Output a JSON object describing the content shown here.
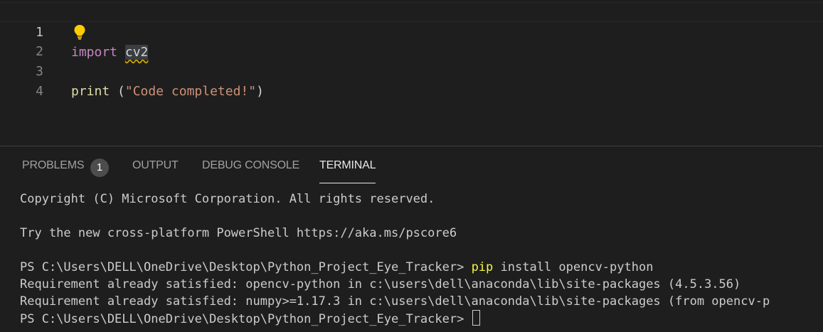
{
  "editor": {
    "line_numbers": [
      "1",
      "2",
      "3",
      "4"
    ],
    "line1": {
      "keyword": "import",
      "module": "cv2"
    },
    "line3": {
      "func": "print",
      "open": " (",
      "string": "\"Code completed!\"",
      "close": ")"
    },
    "lightbulb_icon": "lightbulb-icon"
  },
  "panel": {
    "tabs": {
      "problems": "PROBLEMS",
      "problems_count": "1",
      "output": "OUTPUT",
      "debug_console": "DEBUG CONSOLE",
      "terminal": "TERMINAL"
    },
    "active_tab": "TERMINAL"
  },
  "terminal": {
    "copyright": "Copyright (C) Microsoft Corporation. All rights reserved.",
    "try_new": "Try the new cross-platform PowerShell https://aka.ms/pscore6",
    "prompt1": "PS C:\\Users\\DELL\\OneDrive\\Desktop\\Python_Project_Eye_Tracker> ",
    "cmd_pip": "pip",
    "cmd_rest": " install opencv-python",
    "req1": "Requirement already satisfied: opencv-python in c:\\users\\dell\\anaconda\\lib\\site-packages (4.5.3.56)",
    "req2": "Requirement already satisfied: numpy>=1.17.3 in c:\\users\\dell\\anaconda\\lib\\site-packages (from opencv-p",
    "prompt2": "PS C:\\Users\\DELL\\OneDrive\\Desktop\\Python_Project_Eye_Tracker> "
  },
  "colors": {
    "background": "#1e1e1e",
    "keyword": "#c586c0",
    "string": "#ce9178",
    "function": "#dcdcaa",
    "pip_highlight": "#f5f543",
    "warning_squiggle": "#cca700",
    "lightbulb": "#ffcc00"
  }
}
